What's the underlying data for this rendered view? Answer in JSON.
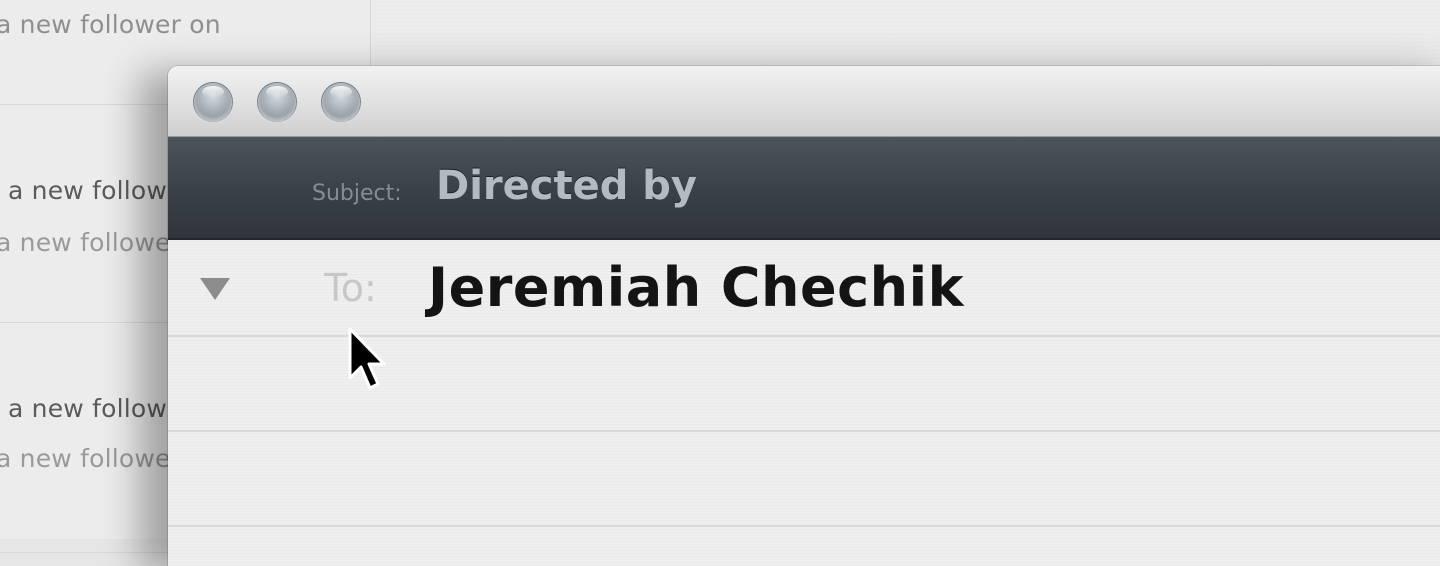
{
  "background_list": {
    "items": [
      {
        "primary": "a new follower on",
        "secondary": ""
      },
      {
        "primary": "a new follower on",
        "secondary": "a new follower on"
      },
      {
        "primary": "a new follower on",
        "secondary": "a new follower on"
      }
    ]
  },
  "compose": {
    "subject_label": "Subject:",
    "subject_value": "Directed by",
    "to_label": "To:",
    "to_value": "Jeremiah Chechik"
  },
  "icons": {
    "close": "close-button-icon",
    "minimize": "minimize-button-icon",
    "zoom": "zoom-button-icon",
    "disclosure": "disclosure-triangle-icon",
    "cursor": "mouse-pointer-icon"
  }
}
